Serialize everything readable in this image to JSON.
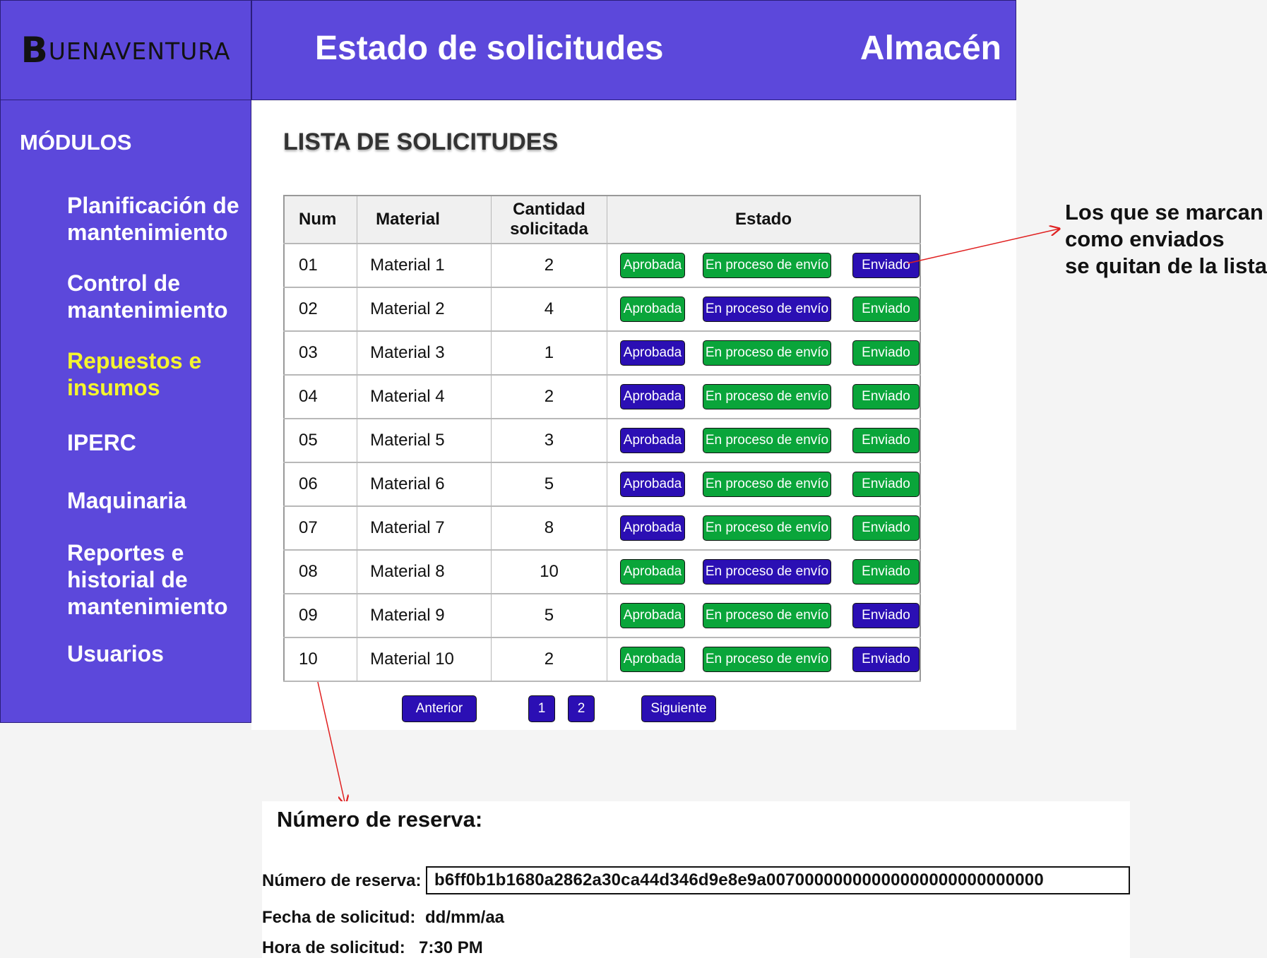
{
  "brand": {
    "initial": "B",
    "rest": "UENAVENTURA"
  },
  "header": {
    "title": "Estado de solicitudes",
    "area": "Almacén"
  },
  "sidebar": {
    "title": "MÓDULOS",
    "items": [
      {
        "label": "Planificación de mantenimiento",
        "active": false
      },
      {
        "label": "Control de mantenimiento",
        "active": false
      },
      {
        "label": "Repuestos e insumos",
        "active": true
      },
      {
        "label": "IPERC",
        "active": false
      },
      {
        "label": "Maquinaria",
        "active": false
      },
      {
        "label": "Reportes e historial de mantenimiento",
        "active": false
      },
      {
        "label": "Usuarios",
        "active": false
      }
    ]
  },
  "list": {
    "title": "LISTA DE SOLICITUDES",
    "columns": [
      "Num",
      "Material",
      "Cantidad solicitada",
      "Estado"
    ],
    "state_labels": [
      "Aprobada",
      "En proceso de envío",
      "Enviado"
    ],
    "rows": [
      {
        "num": "01",
        "material": "Material 1",
        "qty": "2",
        "states": [
          "green",
          "green",
          "blue"
        ]
      },
      {
        "num": "02",
        "material": "Material 2",
        "qty": "4",
        "states": [
          "green",
          "blue",
          "green"
        ]
      },
      {
        "num": "03",
        "material": "Material 3",
        "qty": "1",
        "states": [
          "blue",
          "green",
          "green"
        ]
      },
      {
        "num": "04",
        "material": "Material 4",
        "qty": "2",
        "states": [
          "blue",
          "green",
          "green"
        ]
      },
      {
        "num": "05",
        "material": "Material 5",
        "qty": "3",
        "states": [
          "blue",
          "green",
          "green"
        ]
      },
      {
        "num": "06",
        "material": "Material 6",
        "qty": "5",
        "states": [
          "blue",
          "green",
          "green"
        ]
      },
      {
        "num": "07",
        "material": "Material 7",
        "qty": "8",
        "states": [
          "blue",
          "green",
          "green"
        ]
      },
      {
        "num": "08",
        "material": "Material 8",
        "qty": "10",
        "states": [
          "green",
          "blue",
          "green"
        ]
      },
      {
        "num": "09",
        "material": "Material 9",
        "qty": "5",
        "states": [
          "green",
          "green",
          "blue"
        ]
      },
      {
        "num": "10",
        "material": "Material 10",
        "qty": "2",
        "states": [
          "green",
          "green",
          "blue"
        ]
      }
    ]
  },
  "pagination": {
    "prev": "Anterior",
    "pages": [
      "1",
      "2"
    ],
    "next": "Siguiente"
  },
  "annotation": {
    "lines": [
      "Los que se marcan",
      "como enviados",
      "se quitan de la lista"
    ]
  },
  "reservation": {
    "title": "Número de reserva:",
    "number_label": "Número de reserva:",
    "number_value": "b6ff0b1b1680a2862a30ca44d346d9e8e9a00700000000000000000000000000",
    "date_label": "Fecha de solicitud:",
    "date_value": "dd/mm/aa",
    "time_label": "Hora de solicitud:",
    "time_value": "7:30 PM"
  },
  "colors": {
    "header_bg": "#5c48db",
    "active_nav": "#f5f52e",
    "btn_green": "#0aa53a",
    "btn_blue": "#2b0fb4",
    "arrow": "#e02020"
  }
}
